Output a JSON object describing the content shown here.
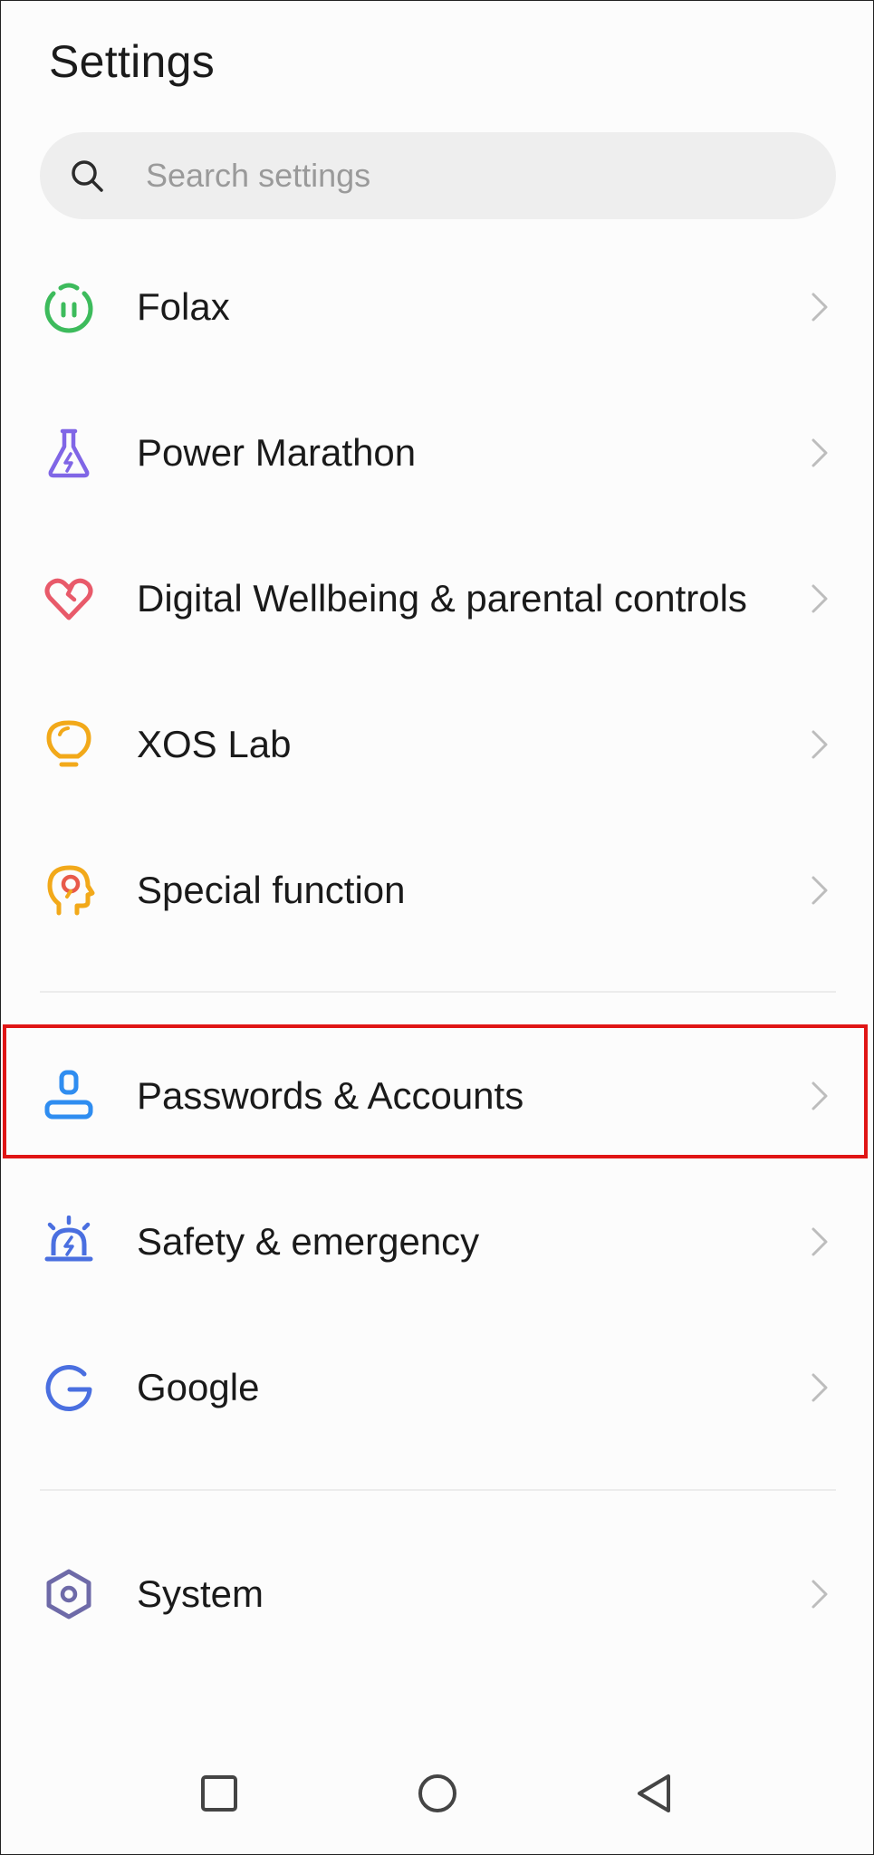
{
  "header": {
    "title": "Settings"
  },
  "search": {
    "placeholder": "Search settings",
    "value": ""
  },
  "settings_items": [
    {
      "label": "Folax",
      "icon": "folax-icon",
      "color": "#3dbb5c"
    },
    {
      "label": "Power Marathon",
      "icon": "flask-icon",
      "color": "#8066e6"
    },
    {
      "label": "Digital Wellbeing & parental controls",
      "icon": "heart-icon",
      "color": "#e85a6a"
    },
    {
      "label": "XOS Lab",
      "icon": "lightbulb-icon",
      "color": "#f2a91a"
    },
    {
      "label": "Special function",
      "icon": "head-icon",
      "color": "#f2a91a"
    },
    {
      "label": "Passwords & Accounts",
      "icon": "account-icon",
      "color": "#2f8df0"
    },
    {
      "label": "Safety & emergency",
      "icon": "siren-icon",
      "color": "#4a6fe0"
    },
    {
      "label": "Google",
      "icon": "google-icon",
      "color": "#4a6fe0"
    },
    {
      "label": "System",
      "icon": "hexagon-nut-icon",
      "color": "#6e6aa8"
    }
  ],
  "highlighted_item": "Passwords & Accounts",
  "highlight_color": "#e01515",
  "nav_bar": {
    "buttons": [
      "recents-square-icon",
      "home-circle-icon",
      "back-triangle-icon"
    ]
  }
}
